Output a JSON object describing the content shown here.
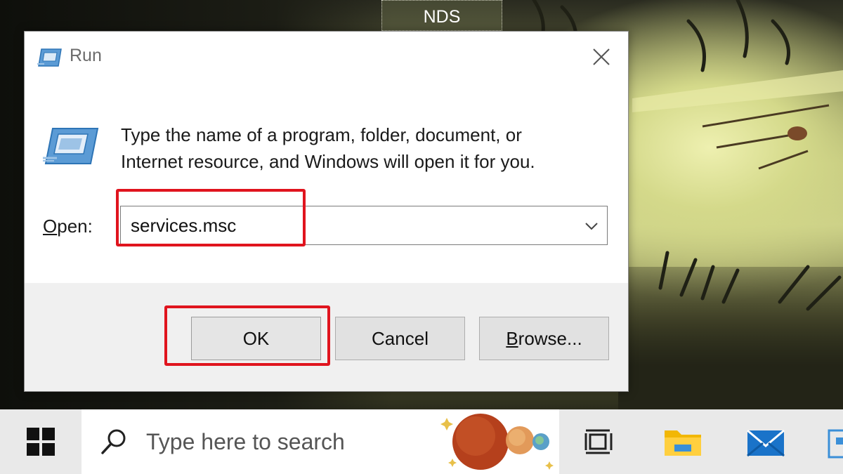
{
  "desktop": {
    "label": "NDS"
  },
  "dialog": {
    "title": "Run",
    "description_line1": "Type the name of a program, folder, document, or",
    "description_line2": "Internet resource, and Windows will open it for you.",
    "open_label_mnemonic": "O",
    "open_label_rest": "pen:",
    "open_value": "services.msc",
    "ok_label": "OK",
    "cancel_label": "Cancel",
    "browse_label_mnemonic": "B",
    "browse_label_rest": "rowse...",
    "highlight_color": "#e0141e"
  },
  "taskbar": {
    "search_placeholder": "Type here to search",
    "icons": [
      "windows-logo-icon",
      "search-icon",
      "task-view-icon",
      "file-explorer-icon",
      "mail-icon"
    ]
  }
}
